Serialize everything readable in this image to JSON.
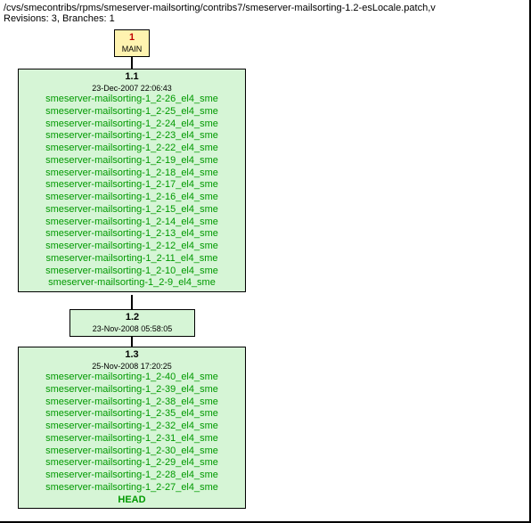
{
  "header": {
    "path": "/cvs/smecontribs/rpms/smeserver-mailsorting/contribs7/smeserver-mailsorting-1.2-esLocale.patch,v",
    "info": "Revisions: 3, Branches: 1"
  },
  "main": {
    "num": "1",
    "label": "MAIN"
  },
  "rev11": {
    "title": "1.1",
    "date": "23-Dec-2007 22:06:43",
    "tags": [
      "smeserver-mailsorting-1_2-26_el4_sme",
      "smeserver-mailsorting-1_2-25_el4_sme",
      "smeserver-mailsorting-1_2-24_el4_sme",
      "smeserver-mailsorting-1_2-23_el4_sme",
      "smeserver-mailsorting-1_2-22_el4_sme",
      "smeserver-mailsorting-1_2-19_el4_sme",
      "smeserver-mailsorting-1_2-18_el4_sme",
      "smeserver-mailsorting-1_2-17_el4_sme",
      "smeserver-mailsorting-1_2-16_el4_sme",
      "smeserver-mailsorting-1_2-15_el4_sme",
      "smeserver-mailsorting-1_2-14_el4_sme",
      "smeserver-mailsorting-1_2-13_el4_sme",
      "smeserver-mailsorting-1_2-12_el4_sme",
      "smeserver-mailsorting-1_2-11_el4_sme",
      "smeserver-mailsorting-1_2-10_el4_sme",
      "smeserver-mailsorting-1_2-9_el4_sme"
    ]
  },
  "rev12": {
    "title": "1.2",
    "date": "23-Nov-2008 05:58:05"
  },
  "rev13": {
    "title": "1.3",
    "date": "25-Nov-2008 17:20:25",
    "tags": [
      "smeserver-mailsorting-1_2-40_el4_sme",
      "smeserver-mailsorting-1_2-39_el4_sme",
      "smeserver-mailsorting-1_2-38_el4_sme",
      "smeserver-mailsorting-1_2-35_el4_sme",
      "smeserver-mailsorting-1_2-32_el4_sme",
      "smeserver-mailsorting-1_2-31_el4_sme",
      "smeserver-mailsorting-1_2-30_el4_sme",
      "smeserver-mailsorting-1_2-29_el4_sme",
      "smeserver-mailsorting-1_2-28_el4_sme",
      "smeserver-mailsorting-1_2-27_el4_sme"
    ],
    "head": "HEAD"
  }
}
